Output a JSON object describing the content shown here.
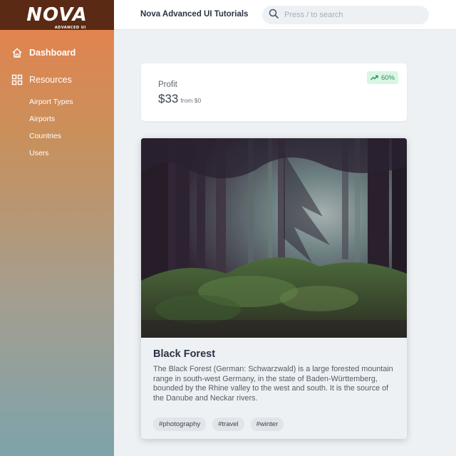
{
  "brand": {
    "logo_text": "NOVA",
    "logo_sub": "ADVANCED UI"
  },
  "header": {
    "title": "Nova Advanced UI Tutorials"
  },
  "search": {
    "placeholder": "Press / to search",
    "icon": "search-icon"
  },
  "sidebar": {
    "items": [
      {
        "label": "Dashboard",
        "icon": "home-icon",
        "active": true
      },
      {
        "label": "Resources",
        "icon": "grid-icon",
        "active": false
      }
    ],
    "subitems": [
      {
        "label": "Airport Types"
      },
      {
        "label": "Airports"
      },
      {
        "label": "Countries"
      },
      {
        "label": "Users"
      }
    ]
  },
  "profit": {
    "label": "Profit",
    "value": "$33",
    "from": "from $0",
    "badge": "60%",
    "badge_icon": "trending-up-icon"
  },
  "article": {
    "title": "Black Forest",
    "body": "The Black Forest (German: Schwarzwald) is a large forested mountain range in south-west Germany, in the state of Baden-Württemberg, bounded by the Rhine valley to the west and south. It is the source of the Danube and Neckar rivers.",
    "tags": [
      "#photography",
      "#travel",
      "#winter"
    ]
  },
  "colors": {
    "accent": "#e8814c",
    "logo_bg": "#5a2a14",
    "badge_bg": "#d9f6e5",
    "badge_text": "#2f8f5a"
  }
}
